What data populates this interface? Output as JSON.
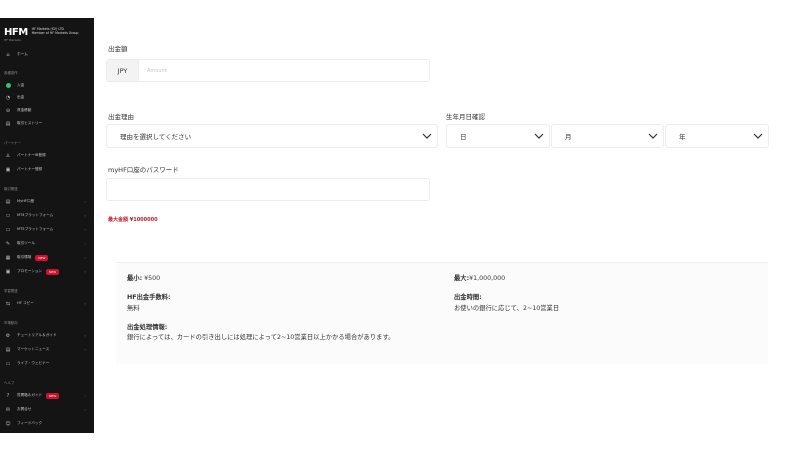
{
  "sidebar": {
    "logo": "HFM",
    "logo_sub": "HF Markets",
    "company_line1": "HF Markets (SV) LTD",
    "company_line2": "Member of HF Markets Group",
    "sections": [
      "各種操作",
      "パートナー",
      "取引関連",
      "学習関連",
      "市場動向",
      "ヘルプ"
    ],
    "items": [
      {
        "label": "ホーム"
      },
      {
        "label": "入金"
      },
      {
        "label": "出金"
      },
      {
        "label": "資金移動"
      },
      {
        "label": "取引ヒストリー"
      },
      {
        "label": "パートナーIB登録"
      },
      {
        "label": "パートナー登録"
      },
      {
        "label": "MyHF口座"
      },
      {
        "label": "MT4プラットフォーム"
      },
      {
        "label": "MT5プラットフォーム"
      },
      {
        "label": "取引ツール"
      },
      {
        "label": "取引環境"
      },
      {
        "label": "プロモーション"
      },
      {
        "label": "HF コピー"
      },
      {
        "label": "チュートリアル＆ガイド"
      },
      {
        "label": "マーケットニュース"
      },
      {
        "label": "ライブ・ウェビナー"
      },
      {
        "label": "質問箱＆ガイド"
      },
      {
        "label": "お問合せ"
      },
      {
        "label": "フィードバック"
      }
    ],
    "badge_new": "NEW"
  },
  "form": {
    "amount_label": "出金額",
    "currency": "JPY",
    "amount_placeholder": "Amount",
    "reason_label": "出金理由",
    "reason_placeholder": "理由を選択してください",
    "dob_label": "生年月日確認",
    "day_label": "日",
    "month_label": "月",
    "year_label": "年",
    "password_label": "myHF口座のパスワード",
    "max_amount": "最大金額 ¥1000000"
  },
  "info": {
    "min_label": "最小:",
    "min_value": "¥500",
    "max_label": "最大:",
    "max_value": "¥1,000,000",
    "fee_label": "HF出金手数料:",
    "fee_value": "無料",
    "time_label": "出金時間:",
    "time_value": "お使いの銀行に応じて、2~10営業日",
    "process_label": "出金処理情報:",
    "process_value": "銀行によっては、カードの引き出しには処理によって2~10営業日以上かかる場合があります。"
  },
  "colors": {
    "sidebar_bg": "#141414",
    "active_green": "#2ec46b",
    "badge_red": "#d0112b",
    "error_red": "#c0202e"
  }
}
